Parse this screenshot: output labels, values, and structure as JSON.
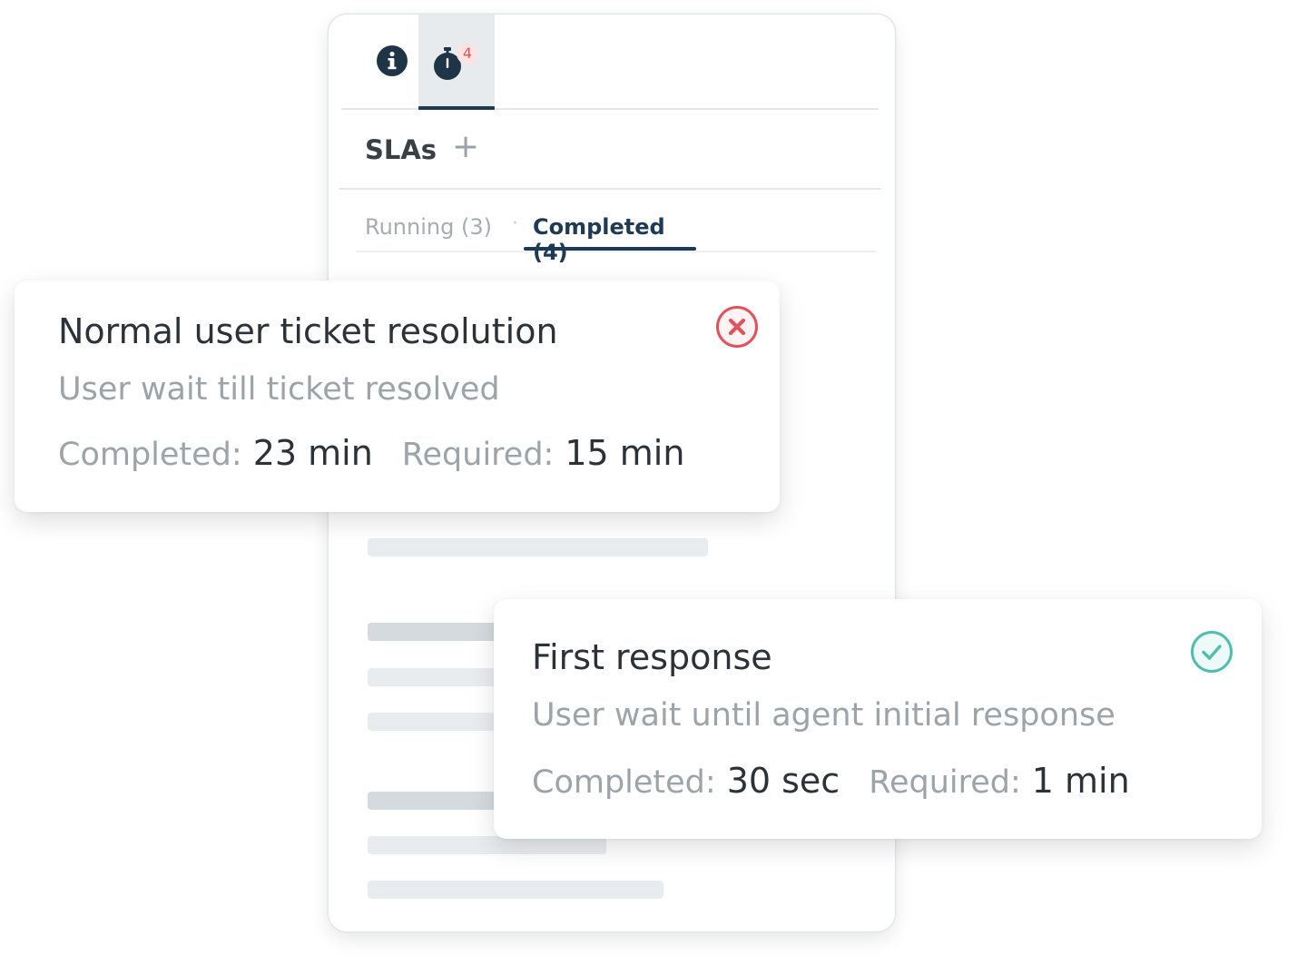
{
  "tabs": {
    "info_icon": "info-icon",
    "timer_icon": "stopwatch-icon",
    "timer_badge": "4"
  },
  "sla": {
    "title": "SLAs",
    "add_icon": "plus-icon",
    "add_label": "+"
  },
  "subtabs": {
    "running": "Running (3)",
    "separator": "·",
    "completed": "Completed (4)",
    "active": "completed"
  },
  "cards": [
    {
      "title": "Normal user ticket resolution",
      "description": "User wait till ticket resolved",
      "completed_label": "Completed:",
      "completed_value": "23 min",
      "required_label": "Required:",
      "required_value": "15 min",
      "status": "failed",
      "status_icon": "x-circle-icon",
      "status_color": "#e2525c"
    },
    {
      "title": "First response",
      "description": "User wait until agent initial response",
      "completed_label": "Completed:",
      "completed_value": "30 sec",
      "required_label": "Required:",
      "required_value": "1 min",
      "status": "met",
      "status_icon": "check-circle-icon",
      "status_color": "#4fbeb0"
    }
  ],
  "colors": {
    "accent": "#1e3a52",
    "fail": "#e2525c",
    "success": "#4fbeb0"
  }
}
